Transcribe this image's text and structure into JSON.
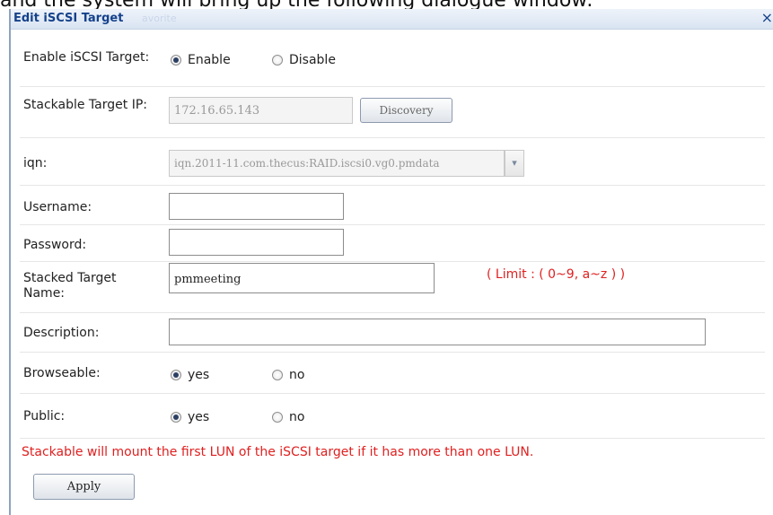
{
  "caption": "and the system will bring up the following dialogue window:",
  "dialog": {
    "title": "Edit iSCSI Target",
    "ghost_tab": "avorite",
    "close_glyph": "×"
  },
  "form": {
    "enable": {
      "label": "Enable iSCSI Target:",
      "options": [
        "Enable",
        "Disable"
      ],
      "selected": "Enable"
    },
    "stackable_ip": {
      "label": "Stackable Target IP:",
      "value": "172.16.65.143",
      "button": "Discovery"
    },
    "iqn": {
      "label": "iqn:",
      "value": "iqn.2011-11.com.thecus:RAID.iscsi0.vg0.pmdata",
      "arrow": "▾"
    },
    "username": {
      "label": "Username:",
      "value": ""
    },
    "password": {
      "label": "Password:",
      "value": ""
    },
    "stacked_name": {
      "label": "Stacked Target Name:",
      "value": "pmmeeting",
      "hint": "( Limit : ( 0~9, a~z ) )"
    },
    "description": {
      "label": "Description:",
      "value": ""
    },
    "browseable": {
      "label": "Browseable:",
      "options": [
        "yes",
        "no"
      ],
      "selected": "yes"
    },
    "public": {
      "label": "Public:",
      "options": [
        "yes",
        "no"
      ],
      "selected": "yes"
    },
    "note": "Stackable will mount the first LUN of the iSCSI target if it has more than one LUN.",
    "apply": "Apply"
  },
  "colors": {
    "title": "#15428b",
    "warning": "#e02020"
  }
}
